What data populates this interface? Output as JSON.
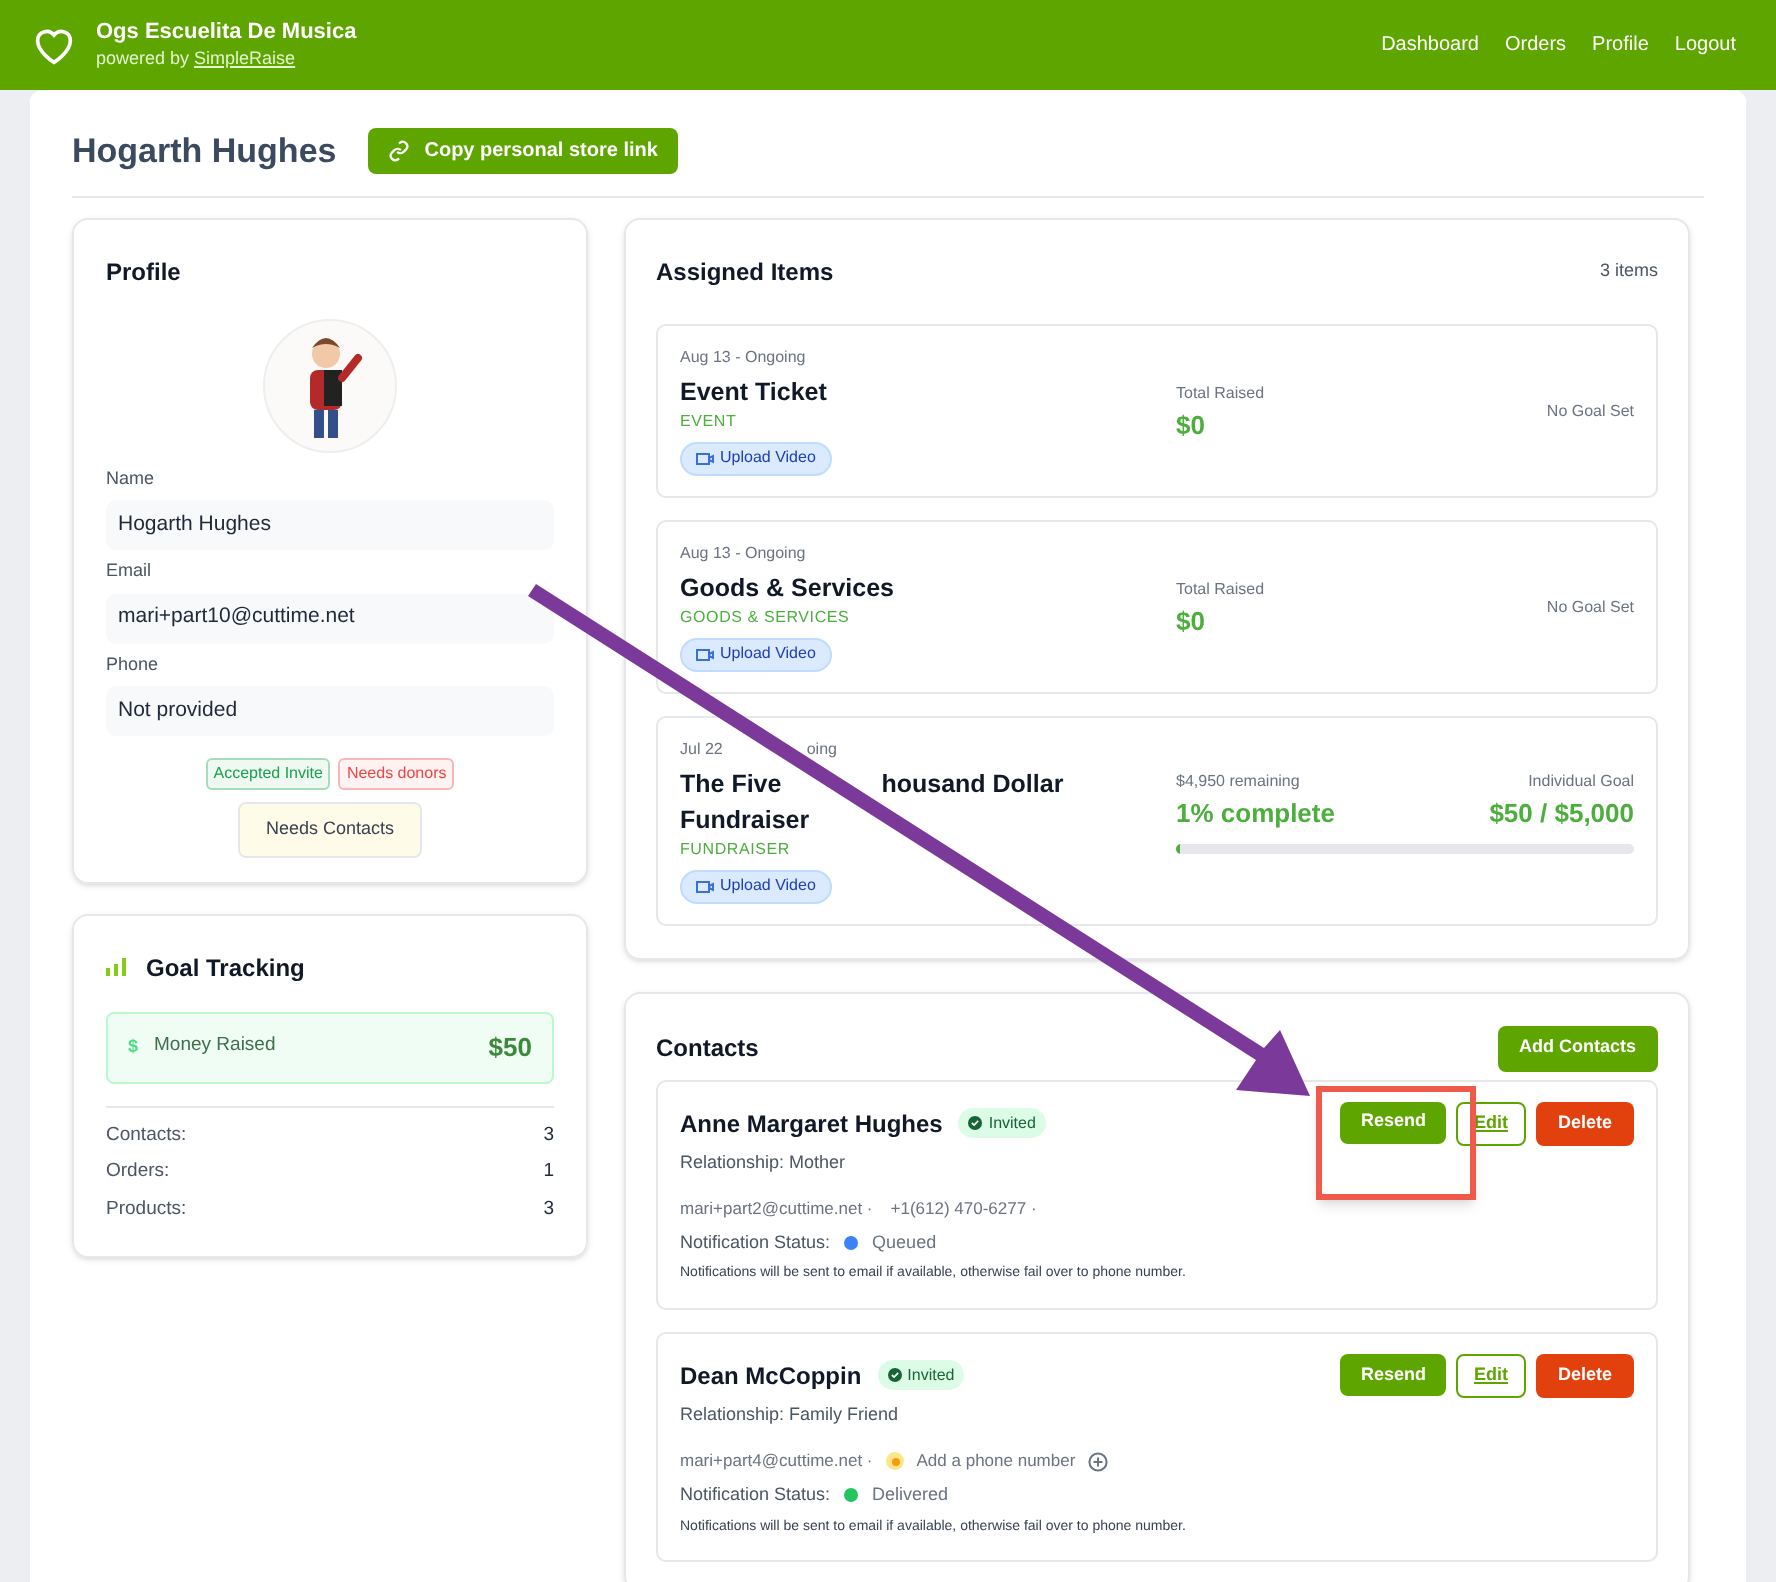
{
  "header": {
    "org_name": "Ogs Escuelita De Musica",
    "powered_by": "powered by",
    "powered_link": "SimpleRaise",
    "nav": [
      "Dashboard",
      "Orders",
      "Profile",
      "Logout"
    ]
  },
  "page": {
    "title": "Hogarth Hughes",
    "copy_button": "Copy personal store link"
  },
  "profile": {
    "title": "Profile",
    "fields": [
      {
        "label": "Name",
        "value": "Hogarth Hughes"
      },
      {
        "label": "Email",
        "value": "mari+part10@cuttime.net"
      },
      {
        "label": "Phone",
        "value": "Not provided"
      }
    ],
    "badges": [
      {
        "label": "Accepted Invite",
        "color": "#16a34a"
      },
      {
        "label": "Needs donors",
        "color": "#ef4444"
      }
    ],
    "needs_contacts": "Needs Contacts"
  },
  "goal_tracking": {
    "title": "Goal Tracking",
    "money_icon": "$",
    "money_label": "Money Raised",
    "money_value": "$50",
    "stats": [
      {
        "label": "Contacts:",
        "value": "3"
      },
      {
        "label": "Orders:",
        "value": "1"
      },
      {
        "label": "Products:",
        "value": "3"
      }
    ]
  },
  "assigned_items": {
    "title": "Assigned Items",
    "count": "3 items",
    "items": [
      {
        "kind": "simple",
        "date": "Aug 13 - Ongoing",
        "name": "Event Ticket",
        "type": "EVENT",
        "upload": "Upload Video",
        "raised_label": "Total Raised",
        "raised": "$0",
        "goal": "No Goal Set"
      },
      {
        "kind": "simple",
        "date": "Aug 13 - Ongoing",
        "name": "Goods & Services",
        "type": "GOODS & SERVICES",
        "upload": "Upload Video",
        "raised_label": "Total Raised",
        "raised": "$0",
        "goal": "No Goal Set"
      },
      {
        "kind": "goal",
        "date_parts": [
          "Jul 22",
          "oing"
        ],
        "name_parts": [
          "The Five",
          "housand Dollar",
          "Fundraiser"
        ],
        "type": "FUNDRAISER",
        "upload": "Upload Video",
        "remaining": "$4,950 remaining",
        "complete": "1% complete",
        "goal_label": "Individual Goal",
        "goal": "$50 / $5,000",
        "level": 0.01
      }
    ]
  },
  "contacts": {
    "title": "Contacts",
    "add_button": "Add Contacts",
    "items": [
      {
        "name": "Anne Margaret Hughes",
        "status": "Invited",
        "relationship": "Relationship: Mother",
        "email": "mari+part2@cuttime.net ·",
        "phone": "+1(612) 470-6277 ·",
        "notification_label": "Notification Status:",
        "notification": "Queued",
        "color": "#3b82f6",
        "note": "Notifications will be sent to email if available, otherwise fail over to phone number.",
        "actions": [
          "Resend",
          "Edit",
          "Delete"
        ],
        "highlighted": true
      },
      {
        "name": "Dean McCoppin",
        "status": "Invited",
        "relationship": "Relationship: Family Friend",
        "email": "mari+part4@cuttime.net ·",
        "add_phone": "Add a phone number",
        "notification_label": "Notification Status:",
        "notification": "Delivered",
        "color": "#22c55e",
        "note": "Notifications will be sent to email if available, otherwise fail over to phone number.",
        "actions": [
          "Resend",
          "Edit",
          "Delete"
        ],
        "highlighted": false
      }
    ]
  }
}
